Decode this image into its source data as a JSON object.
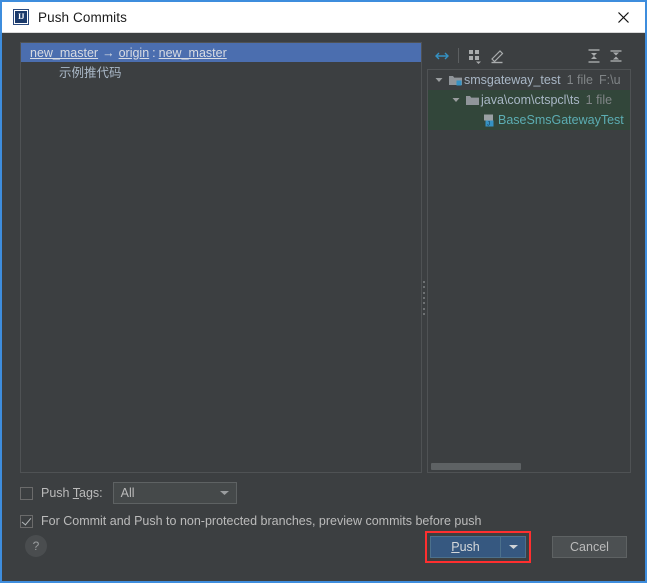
{
  "window": {
    "title": "Push Commits",
    "icon": "intellij-idea-icon",
    "close_label": "×",
    "accent_border": "#3e8ddd"
  },
  "commits_panel": {
    "branch": {
      "source": "new_master",
      "arrow": "→",
      "remote": "origin",
      "separator": ":",
      "target": "new_master"
    },
    "commits": [
      {
        "message": "示例推代码"
      }
    ],
    "selection_color": "#4b6eaf"
  },
  "changes_panel": {
    "toolbar": [
      {
        "name": "collapse-selection-icon",
        "tooltip": "Expand Selection"
      },
      {
        "name": "group-by-icon",
        "tooltip": "Group By"
      },
      {
        "name": "edit-source-icon",
        "tooltip": "Edit Source"
      },
      {
        "name": "expand-all-icon",
        "tooltip": "Expand All"
      },
      {
        "name": "collapse-all-icon",
        "tooltip": "Collapse All"
      }
    ],
    "tree": [
      {
        "depth": 0,
        "expanded": true,
        "icon": "module-icon",
        "label": "smsgateway_test",
        "count": "1 file",
        "path": "F:\\u",
        "kind": "module",
        "highlighted": false
      },
      {
        "depth": 1,
        "expanded": true,
        "icon": "folder-icon",
        "label": "java\\com\\ctspcl\\ts",
        "count": "1 file",
        "path": "",
        "kind": "folder",
        "highlighted": true
      },
      {
        "depth": 2,
        "expanded": null,
        "icon": "java-class-icon",
        "label": "BaseSmsGatewayTest",
        "count": "",
        "path": "",
        "kind": "file",
        "highlighted": true
      }
    ],
    "new_file_color": "#5cadb3",
    "highlight_color": "#32463a"
  },
  "options": {
    "push_tags": {
      "label_pre": "Push ",
      "label_mnemonic": "T",
      "label_post": "ags:",
      "checked": false,
      "dropdown_value": "All"
    },
    "preview_commits": {
      "label": "For Commit and Push to non-protected branches, preview commits before push",
      "checked": true
    }
  },
  "footer": {
    "help_label": "?",
    "push": {
      "label_pre": "",
      "label_mnemonic": "P",
      "label_post": "ush",
      "highlight_color": "#ff2f2f"
    },
    "cancel_label": "Cancel"
  }
}
